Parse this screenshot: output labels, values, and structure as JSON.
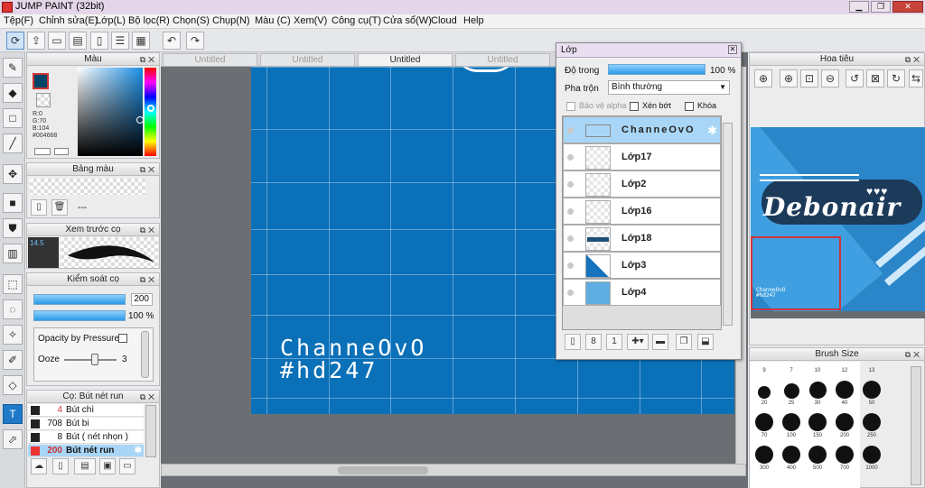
{
  "window": {
    "title": "JUMP PAINT (32bit)"
  },
  "menu": [
    "Tệp(F)",
    "Chỉnh sửa(E)",
    "Lớp(L)",
    "Bộ lọc(R)",
    "Chọn(S)",
    "Chụp(N)",
    "Màu (C)",
    "Xem(V)",
    "Công cụ(T)",
    "Cửa sổ(W)",
    "Cloud",
    "Help"
  ],
  "tabs": [
    "Untitled",
    "Untitled",
    "Untitled",
    "Untitled"
  ],
  "color_panel": {
    "title": "Màu",
    "r": "R:0",
    "g": "G:70",
    "b": "B:104",
    "hex": "#004668",
    "current_color": "#004668"
  },
  "palette_panel": {
    "title": "Bảng màu",
    "value": "---"
  },
  "brush_preview": {
    "title": "Xem trước cọ",
    "size": "14.5"
  },
  "brush_control": {
    "title": "Kiểm soát cọ",
    "size_value": "200",
    "opacity_value": "100 %",
    "opacity_pressure_label": "Opacity by Pressure",
    "ooze_label": "Ooze",
    "ooze_value": "3"
  },
  "brush_list": {
    "title": "Cọ: Bút nét run",
    "items": [
      {
        "count": "4",
        "name": "Bút chì",
        "count_color": "#c93030"
      },
      {
        "count": "708",
        "name": "Bút bi",
        "count_color": "#111111"
      },
      {
        "count": "8",
        "name": "Bút ( nét nhọn )",
        "count_color": "#111111"
      },
      {
        "count": "200",
        "name": "Bút nét run",
        "count_color": "#c93030"
      }
    ]
  },
  "canvas": {
    "line1": "ChanneOvO",
    "line2": "#hd247"
  },
  "layer_panel": {
    "title": "Lớp",
    "opacity_label": "Độ trong",
    "opacity_value": "100 %",
    "blend_label": "Pha trộn",
    "blend_value": "Bình thường",
    "protect_alpha": "Bảo vệ alpha",
    "clipping": "Xén bớt",
    "lock": "Khóa",
    "layers": [
      "ChanneOvO",
      "Lớp17",
      "Lớp2",
      "Lớp16",
      "Lớp18",
      "Lớp3",
      "Lớp4"
    ]
  },
  "navigator": {
    "title": "Hoa tiêu",
    "art_text": "Debonair",
    "mini_line1": "ChanneOvO",
    "mini_line2": "#hd247"
  },
  "brush_size": {
    "title": "Brush Size",
    "sizes": [
      "9",
      "7",
      "10",
      "12",
      "13",
      "20",
      "25",
      "30",
      "40",
      "50",
      "70",
      "100",
      "150",
      "200",
      "250",
      "300",
      "400",
      "500",
      "700",
      "1000",
      "400",
      "300",
      "700",
      "1000"
    ]
  }
}
